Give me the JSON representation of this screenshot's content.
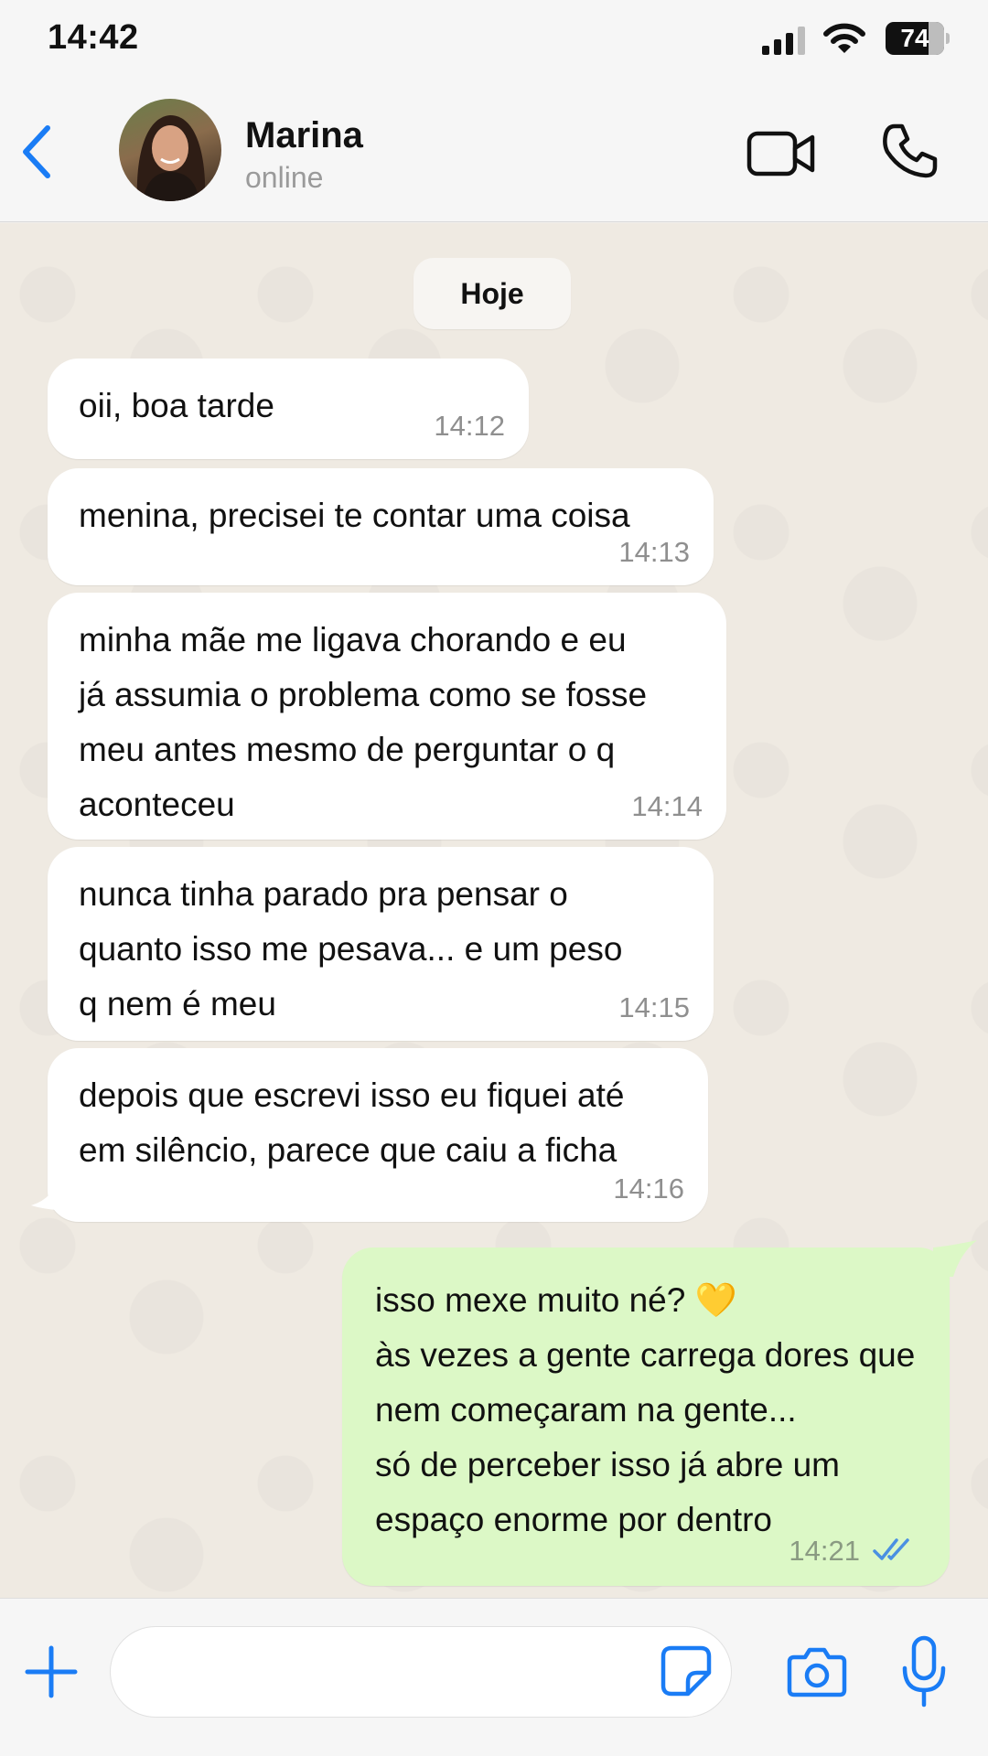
{
  "status_bar": {
    "time": "14:42",
    "battery": "74",
    "battery_level": 0.74
  },
  "header": {
    "contact_name": "Marina",
    "contact_status": "online"
  },
  "chat": {
    "date_label": "Hoje",
    "messages": [
      {
        "direction": "in",
        "text": "oii, boa tarde",
        "time": "14:12"
      },
      {
        "direction": "in",
        "text": "menina, precisei te contar uma coisa",
        "time": "14:13"
      },
      {
        "direction": "in",
        "text": "minha mãe me ligava chorando e eu\njá assumia o problema como se fosse\nmeu antes mesmo de perguntar o q\naconteceu",
        "time": "14:14"
      },
      {
        "direction": "in",
        "text": "nunca tinha parado pra pensar o\nquanto isso me pesava... e um peso\nq nem é meu",
        "time": "14:15"
      },
      {
        "direction": "in",
        "text": "depois que escrevi isso eu fiquei até\nem silêncio, parece que caiu a ficha",
        "time": "14:16"
      },
      {
        "direction": "out",
        "text": "isso mexe muito né? 💛\nàs vezes a gente carrega dores que\nnem começaram na gente...\nsó de perceber isso já abre um\nespaço enorme por dentro",
        "time": "14:21",
        "status": "read"
      }
    ]
  },
  "input": {
    "placeholder": ""
  },
  "icons": {
    "back": "chevron-left-icon",
    "video": "video-camera-icon",
    "phone": "phone-icon",
    "plus": "plus-icon",
    "sticker": "sticker-icon",
    "camera": "camera-icon",
    "mic": "microphone-icon"
  },
  "colors": {
    "accent": "#1a7cf5",
    "incoming_bubble": "#ffffff",
    "outgoing_bubble": "#dcf8c6",
    "chat_background": "#efeae2",
    "read_ticks": "#4a90e2"
  }
}
